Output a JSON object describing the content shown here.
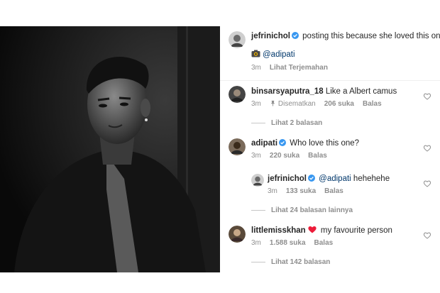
{
  "post": {
    "author": "jefrinichol",
    "caption": "posting this because she loved this one",
    "credit_mention": "@adipati",
    "time": "3m",
    "translate_label": "Lihat Terjemahan"
  },
  "comments": [
    {
      "username": "binsarsyaputra_18",
      "text": "Like a Albert camus",
      "time": "3m",
      "pinned_label": "Disematkan",
      "likes": "206 suka",
      "reply_label": "Balas",
      "view_replies": "Lihat 2 balasan"
    },
    {
      "username": "adipati",
      "text": "Who love this one?",
      "time": "3m",
      "likes": "220 suka",
      "reply_label": "Balas",
      "reply": {
        "username": "jefrinichol",
        "mention": "@adipati",
        "text": "hehehehe",
        "time": "3m",
        "likes": "133 suka",
        "reply_label": "Balas"
      },
      "view_replies": "Lihat 24 balasan lainnya"
    },
    {
      "username": "littlemisskhan",
      "text": "my favourite person",
      "time": "3m",
      "likes": "1.588 suka",
      "reply_label": "Balas",
      "view_replies": "Lihat 142 balasan"
    }
  ],
  "colors": {
    "verified": "#3897f0",
    "mention": "#00376b",
    "meta": "#8e8e8e",
    "heart_emoji": "#ed1c3a"
  },
  "icons": [
    "verified-badge-icon",
    "camera-emoji-icon",
    "pin-icon",
    "heart-outline-icon",
    "red-heart-emoji-icon"
  ]
}
